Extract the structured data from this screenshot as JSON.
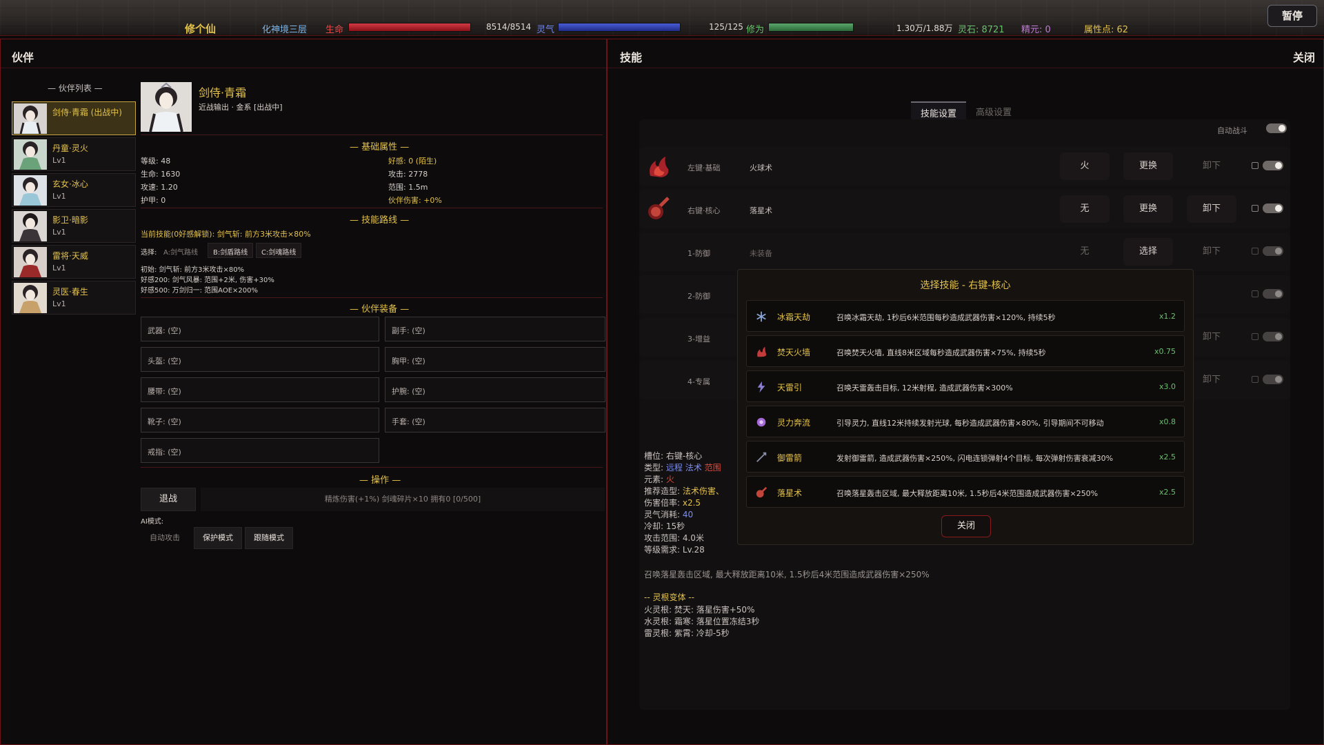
{
  "hud": {
    "title": "修个仙",
    "realm": "化神境三层",
    "hp_label": "生命",
    "hp_value": "8514/8514",
    "hp_fill": 1.0,
    "mp_label": "灵气",
    "mp_value": "125/125",
    "mp_fill": 1.0,
    "cult_label": "修为",
    "cult_value": "1.30万/1.88万",
    "cult_fill": 0.69,
    "lingshi": "灵石: 8721",
    "jingyuan": "精元: 0",
    "attr_points": "属性点: 62",
    "pause": "暂停"
  },
  "left": {
    "title": "伙伴",
    "list_title": "— 伙伴列表 —",
    "partners": [
      {
        "name": "剑侍·青霜 (出战中)",
        "level": ""
      },
      {
        "name": "丹童·灵火",
        "level": "Lv1"
      },
      {
        "name": "玄女·冰心",
        "level": "Lv1"
      },
      {
        "name": "影卫·暗影",
        "level": "Lv1"
      },
      {
        "name": "雷将·天威",
        "level": "Lv1"
      },
      {
        "name": "灵医·春生",
        "level": "Lv1"
      }
    ],
    "selected": {
      "name": "剑侍·青霜",
      "role": "近战输出 · 金系 [出战中]"
    },
    "basic_title": "— 基础属性 —",
    "stats": {
      "level": "等级: 48",
      "favor": "好感: 0 (陌生)",
      "life": "生命: 1630",
      "attack": "攻击: 2778",
      "speed": "攻速: 1.20",
      "range": "范围: 1.5m",
      "armor": "护甲: 0",
      "partner_dmg": "伙伴伤害: +0%"
    },
    "path_title": "— 技能路线 —",
    "current_skill": "当前技能(0好感解锁): 剑气斩: 前方3米攻击×80%",
    "choose_label": "选择:",
    "paths": [
      "A:剑气路线",
      "B:剑盾路线",
      "C:剑魂路线"
    ],
    "path_lines": [
      "初始: 剑气斩: 前方3米攻击×80%",
      "好感200: 剑气风暴: 范围+2米, 伤害+30%",
      "好感500: 万剑归一: 范围AOE×200%"
    ],
    "equip_title": "— 伙伴装备 —",
    "equip": [
      "武器: (空)",
      "副手: (空)",
      "头盔: (空)",
      "胸甲: (空)",
      "腰带: (空)",
      "护腕: (空)",
      "靴子: (空)",
      "手套: (空)",
      "戒指: (空)"
    ],
    "ops_title": "— 操作 —",
    "retreat": "退战",
    "refine_info": "精炼伤害(+1%) 剑魂碎片×10 拥有0 [0/500]",
    "ai_label": "AI模式:",
    "ai_modes": [
      "自动攻击",
      "保护模式",
      "跟随模式"
    ]
  },
  "right": {
    "title": "技能",
    "close": "关闭",
    "tabs": [
      "技能设置",
      "高级设置"
    ],
    "auto_battle": "自动战斗",
    "rows": [
      {
        "slot": "左键·基础",
        "skill": "火球术",
        "element": "火",
        "change": "更换",
        "unload": "卸下"
      },
      {
        "slot": "右键·核心",
        "skill": "落星术",
        "element": "无",
        "change": "更换",
        "unload": "卸下"
      },
      {
        "slot": "1-防御",
        "skill": "未装备",
        "element": "无",
        "change": "选择",
        "unload": "卸下"
      },
      {
        "slot": "2-防御",
        "skill": "",
        "element": "",
        "change": "",
        "unload": ""
      },
      {
        "slot": "3-增益",
        "skill": "",
        "element": "",
        "change": "",
        "unload": "卸下"
      },
      {
        "slot": "4-专属",
        "skill": "",
        "element": "",
        "change": "",
        "unload": "卸下"
      }
    ],
    "detail": {
      "slot": "槽位: 右键-核心",
      "type_label": "类型:",
      "type_a": "远程",
      "type_b": "法术",
      "type_c": "范围",
      "element_label": "元素:",
      "element": "火",
      "recommend_label": "推荐造型:",
      "recommend": "法术伤害、",
      "multiplier_label": "伤害倍率:",
      "multiplier": "x2.5",
      "mana_label": "灵气消耗:",
      "mana": "40",
      "cooldown": "冷却: 15秒",
      "range": "攻击范围: 4.0米",
      "level_req": "等级需求: Lv.28",
      "desc": "召唤落星轰击区域, 最大释放距离10米, 1.5秒后4米范围造成武器伤害×250%",
      "variant_title": "-- 灵根变体 --",
      "variants": [
        "火灵根: 焚天: 落星伤害+50%",
        "水灵根: 霜寒: 落星位置冻结3秒",
        "雷灵根: 紫霄: 冷却-5秒"
      ]
    },
    "modal": {
      "title": "选择技能 - 右键-核心",
      "options": [
        {
          "name": "冰霜天劫",
          "desc": "召唤冰霜天劫, 1秒后6米范围每秒造成武器伤害×120%, 持续5秒",
          "mult": "x1.2",
          "icon": "ice-icon",
          "color": "#8aa6d8"
        },
        {
          "name": "焚天火墙",
          "desc": "召唤焚天火墙, 直线8米区域每秒造成武器伤害×75%, 持续5秒",
          "mult": "x0.75",
          "icon": "fire-wall-icon",
          "color": "#c23a3a"
        },
        {
          "name": "天雷引",
          "desc": "召唤天雷轰击目标, 12米射程, 造成武器伤害×300%",
          "mult": "x3.0",
          "icon": "thunder-icon",
          "color": "#8a7fd0"
        },
        {
          "name": "灵力奔流",
          "desc": "引导灵力, 直线12米持续发射光球, 每秒造成武器伤害×80%, 引导期间不可移动",
          "mult": "x0.8",
          "icon": "spirit-orb-icon",
          "color": "#a66ad8"
        },
        {
          "name": "御雷箭",
          "desc": "发射御雷箭, 造成武器伤害×250%, 闪电连锁弹射4个目标, 每次弹射伤害衰减30%",
          "mult": "x2.5",
          "icon": "thunder-arrow-icon",
          "color": "#8a8fa8"
        },
        {
          "name": "落星术",
          "desc": "召唤落星轰击区域, 最大释放距离10米, 1.5秒后4米范围造成武器伤害×250%",
          "mult": "x2.5",
          "icon": "meteor-icon",
          "color": "#c2443a"
        }
      ],
      "close": "关闭"
    }
  }
}
